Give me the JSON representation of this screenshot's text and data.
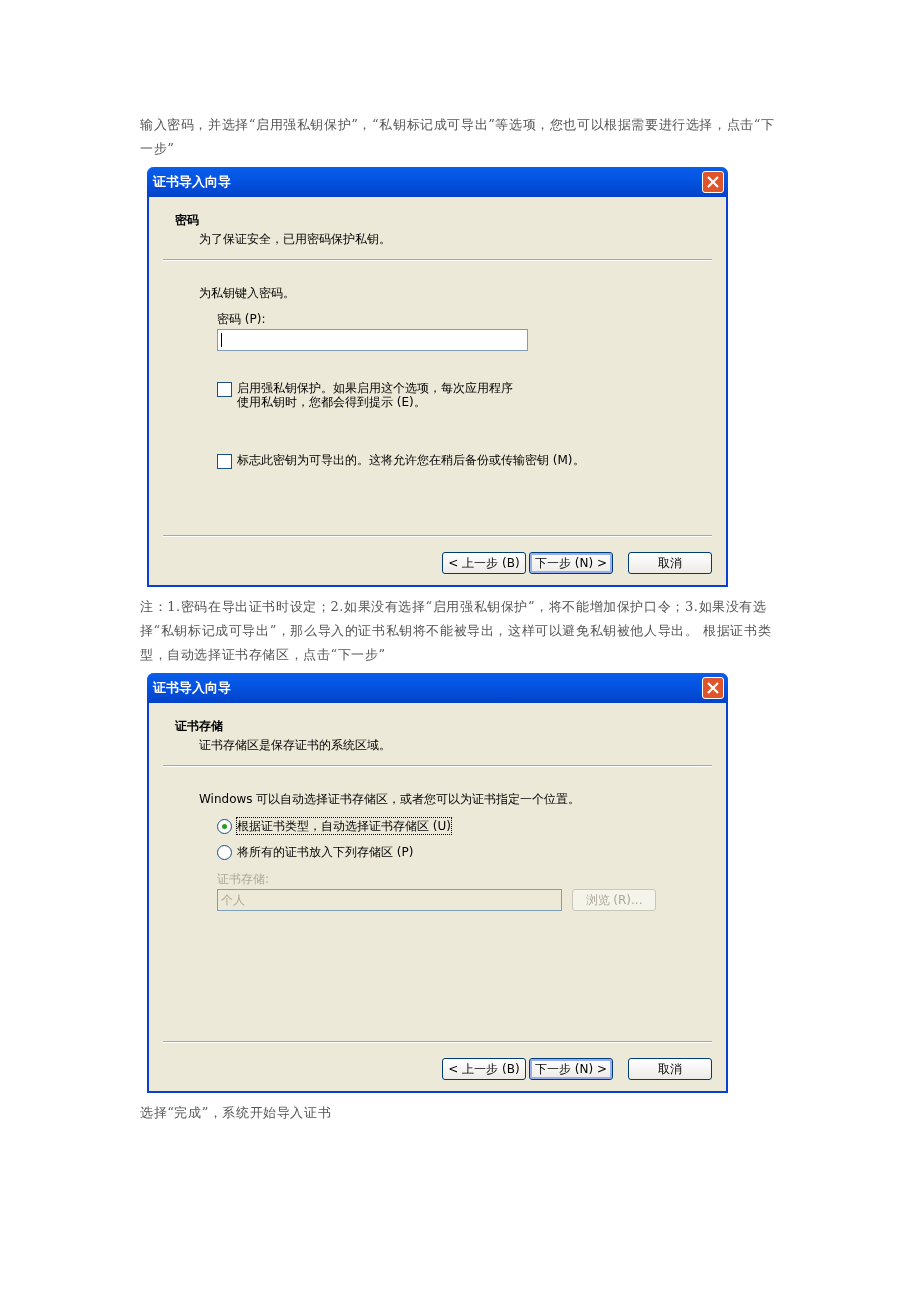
{
  "blocks": [
    {
      "kind": "paragraph",
      "text": "输入密码，并选择“启用强私钥保护”，“私钥标记成可导出”等选项，您也可以根据需要进行选择，点击“下一步”"
    },
    {
      "kind": "dialog",
      "title": "证书导入向导",
      "header": {
        "title": "密码",
        "subtitle": "为了保证安全，已用密码保护私钥。"
      },
      "body": [
        {
          "kind": "text",
          "text": "为私钥键入密码。"
        },
        {
          "kind": "field",
          "label": "密码 (P):",
          "focused": true,
          "disabled": false
        },
        {
          "kind": "checkbox",
          "lines": [
            "启用强私钥保护。如果启用这个选项，每次应用程序",
            "使用私钥时，您都会得到提示 (E)。"
          ],
          "checked": false
        },
        {
          "kind": "checkbox",
          "lines": [
            "标志此密钥为可导出的。这将允许您在稍后备份或传输密钥 (M)。"
          ],
          "checked": false
        }
      ],
      "buttons": [
        {
          "label": "< 上一步 (B)",
          "default": false
        },
        {
          "label": "下一步 (N) >",
          "default": true
        },
        {
          "label": "取消",
          "default": false
        }
      ]
    },
    {
      "kind": "paragraph",
      "text": "注：1.密码在导出证书时设定；2.如果没有选择“启用强私钥保护”，将不能增加保护口令；3.如果没有选择“私钥标记成可导出”，那么导入的证书私钥将不能被导出，这样可以避免私钥被他人导出。 根据证书类型，自动选择证书存储区，点击“下一步”"
    },
    {
      "kind": "dialog",
      "title": "证书导入向导",
      "header": {
        "title": "证书存储",
        "subtitle": "证书存储区是保存证书的系统区域。"
      },
      "body": [
        {
          "kind": "text",
          "text": "Windows 可以自动选择证书存储区，或者您可以为证书指定一个位置。"
        },
        {
          "kind": "radio",
          "label": "根据证书类型，自动选择证书存储区 (U)",
          "selected": true,
          "focused": true
        },
        {
          "kind": "radio",
          "label": "将所有的证书放入下列存储区 (P)",
          "selected": false,
          "focused": false
        },
        {
          "kind": "field",
          "label": "证书存储:",
          "value": "个人",
          "button": "浏览 (R)...",
          "focused": false,
          "disabled": true
        }
      ],
      "buttons": [
        {
          "label": "< 上一步 (B)",
          "default": false
        },
        {
          "label": "下一步 (N) >",
          "default": true
        },
        {
          "label": "取消",
          "default": false
        }
      ]
    },
    {
      "kind": "paragraph",
      "text": "选择“完成”，系统开始导入证书"
    }
  ]
}
